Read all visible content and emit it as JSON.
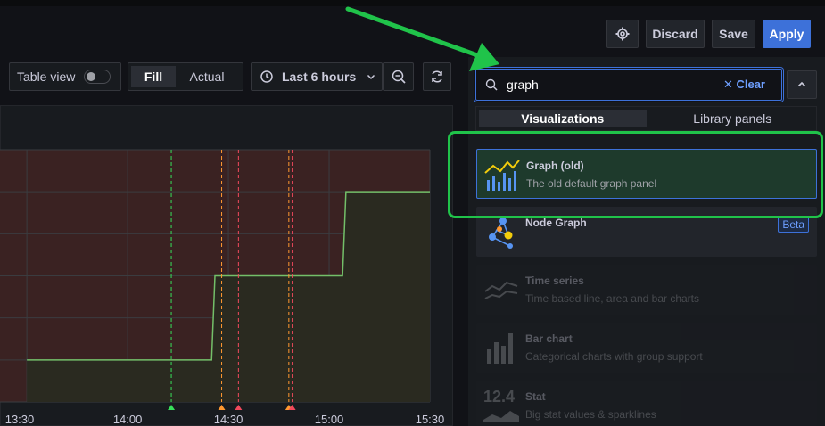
{
  "toolbar": {
    "discard_label": "Discard",
    "save_label": "Save",
    "apply_label": "Apply",
    "table_view_label": "Table view",
    "fill_label": "Fill",
    "actual_label": "Actual",
    "time_range_label": "Last 6 hours"
  },
  "search": {
    "value": "graph",
    "clear_label": "Clear"
  },
  "tabs": [
    "Visualizations",
    "Library panels"
  ],
  "results": [
    {
      "title": "Graph (old)",
      "description": "The old default graph panel",
      "selected": true
    },
    {
      "title": "Node Graph",
      "description": "",
      "badge": "Beta"
    },
    {
      "title": "Time series",
      "description": "Time based line, area and bar charts"
    },
    {
      "title": "Bar chart",
      "description": "Categorical charts with group support"
    },
    {
      "title": "Stat",
      "description": "Big stat values & sparklines",
      "icon_text": "12.4"
    }
  ],
  "chart_data": {
    "type": "line",
    "x_ticks": [
      "13:30",
      "14:00",
      "14:30",
      "15:00",
      "15:30"
    ],
    "x": [
      "13:30",
      "14:25",
      "14:26",
      "15:04",
      "15:05",
      "15:30"
    ],
    "values": [
      1,
      1,
      3,
      3,
      5,
      5
    ],
    "annotations": [
      "14:13",
      "14:28",
      "14:33",
      "14:48",
      "14:49"
    ],
    "colors": {
      "line": "#73bf69",
      "threshold_fill": "#3a2222",
      "base_fill": "#2a2a20"
    }
  },
  "colors": {
    "accent": "#3d71d9",
    "highlight": "#20c34a"
  }
}
